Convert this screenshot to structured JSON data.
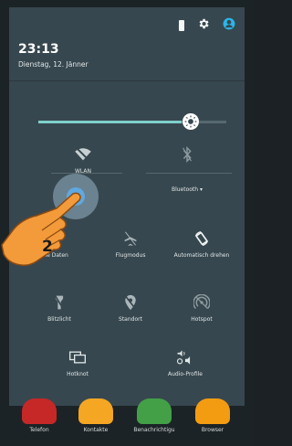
{
  "status": {
    "time": "23:13",
    "date": "Dienstag, 12. Jänner"
  },
  "brightness": {
    "level": 0.76
  },
  "tiles": {
    "wlan": {
      "label": "WLAN"
    },
    "bluetooth": {
      "label": "Bluetooth",
      "caret": "▾"
    },
    "mobile_data": {
      "label": "Mobile Daten"
    },
    "airplane": {
      "label": "Flugmodus"
    },
    "auto_rotate": {
      "label": "Automatisch drehen"
    },
    "flashlight": {
      "label": "Blitzlicht"
    },
    "location": {
      "label": "Standort"
    },
    "hotspot": {
      "label": "Hotspot"
    },
    "cast": {
      "label": "Hotknot"
    },
    "audio": {
      "label": "Audio-Profile"
    }
  },
  "annotation": {
    "step": "2"
  },
  "dock": [
    {
      "label": "Telefon",
      "color": "#c62828"
    },
    {
      "label": "Kontakte",
      "color": "#f5a623"
    },
    {
      "label": "Benachrichtigu",
      "color": "#43a047"
    },
    {
      "label": "Browser",
      "color": "#f39c12"
    }
  ],
  "colors": {
    "accent": "#7ecfcb",
    "panel": "#37474f"
  }
}
